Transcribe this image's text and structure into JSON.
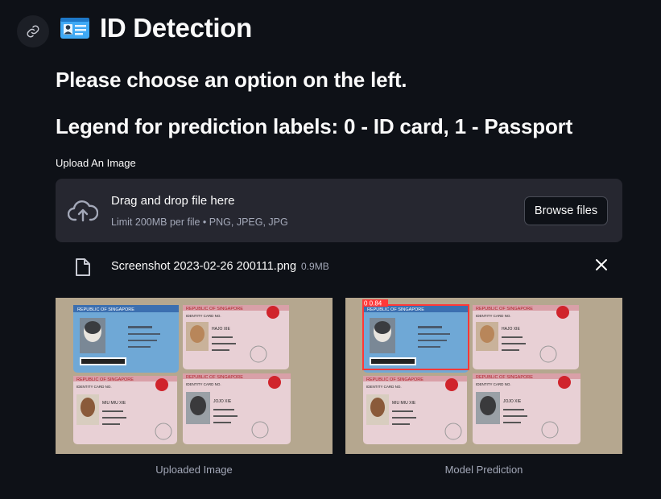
{
  "header": {
    "title": "ID Detection",
    "title_icon": "id-card-emoji-icon",
    "anchor_icon": "link-icon"
  },
  "instructions": {
    "choose_option": "Please choose an option on the left.",
    "legend": "Legend for prediction labels: 0 - ID card, 1 - Passport"
  },
  "uploader": {
    "label": "Upload An Image",
    "drop_text": "Drag and drop file here",
    "limit_text": "Limit 200MB per file • PNG, JPEG, JPG",
    "browse_label": "Browse files",
    "upload_icon": "cloud-upload-icon"
  },
  "uploaded_file": {
    "name": "Screenshot 2023-02-26 200111.png",
    "size": "0.9MB",
    "file_icon": "file-icon",
    "remove_icon": "close-icon"
  },
  "images": {
    "left_caption": "Uploaded Image",
    "right_caption": "Model Prediction",
    "detection_label": "0  0.84",
    "card_header": "REPUBLIC OF SINGAPORE",
    "card_subheader": "IDENTITY CARD NO.",
    "card_names": [
      "HAJO XIE",
      "MIU MIU XIE",
      "JOJO XIE"
    ]
  },
  "colors": {
    "background": "#0e1117",
    "dropzone": "#262730",
    "detection_box": "#ff3838"
  }
}
